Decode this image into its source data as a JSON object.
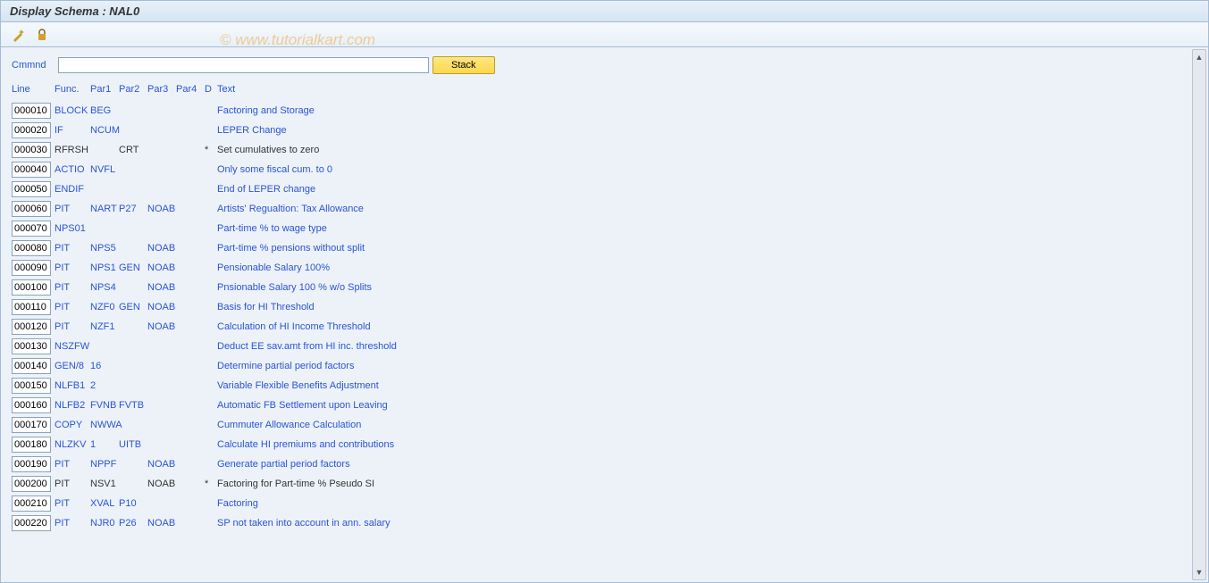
{
  "window": {
    "title": "Display Schema : NAL0"
  },
  "toolbar": {
    "icon1": "wand-icon",
    "icon2": "lock-icon"
  },
  "watermark": "© www.tutorialkart.com",
  "command": {
    "label": "Cmmnd",
    "value": "",
    "stack_label": "Stack"
  },
  "headers": {
    "line": "Line",
    "func": "Func.",
    "par1": "Par1",
    "par2": "Par2",
    "par3": "Par3",
    "par4": "Par4",
    "d": "D",
    "text": "Text"
  },
  "rows": [
    {
      "line": "000010",
      "func": "BLOCK",
      "par1": "BEG",
      "par2": "",
      "par3": "",
      "par4": "",
      "d": "",
      "text": "Factoring and Storage",
      "link": true
    },
    {
      "line": "000020",
      "func": "IF",
      "par1": "NCUM",
      "par2": "",
      "par3": "",
      "par4": "",
      "d": "",
      "text": "LEPER Change",
      "link": true
    },
    {
      "line": "000030",
      "func": "RFRSH",
      "par1": "",
      "par2": "CRT",
      "par3": "",
      "par4": "",
      "d": "*",
      "text": "Set cumulatives to zero",
      "link": false
    },
    {
      "line": "000040",
      "func": "ACTIO",
      "par1": "NVFL",
      "par2": "",
      "par3": "",
      "par4": "",
      "d": "",
      "text": "Only some fiscal cum. to 0",
      "link": true
    },
    {
      "line": "000050",
      "func": "ENDIF",
      "par1": "",
      "par2": "",
      "par3": "",
      "par4": "",
      "d": "",
      "text": "End of LEPER change",
      "link": true
    },
    {
      "line": "000060",
      "func": "PIT",
      "par1": "NART",
      "par2": "P27",
      "par3": "NOAB",
      "par4": "",
      "d": "",
      "text": "Artists' Regualtion: Tax Allowance",
      "link": true
    },
    {
      "line": "000070",
      "func": "NPS01",
      "par1": "",
      "par2": "",
      "par3": "",
      "par4": "",
      "d": "",
      "text": "Part-time % to wage type",
      "link": true
    },
    {
      "line": "000080",
      "func": "PIT",
      "par1": "NPS5",
      "par2": "",
      "par3": "NOAB",
      "par4": "",
      "d": "",
      "text": "Part-time % pensions without split",
      "link": true
    },
    {
      "line": "000090",
      "func": "PIT",
      "par1": "NPS1",
      "par2": "GEN",
      "par3": "NOAB",
      "par4": "",
      "d": "",
      "text": "Pensionable Salary 100%",
      "link": true
    },
    {
      "line": "000100",
      "func": "PIT",
      "par1": "NPS4",
      "par2": "",
      "par3": "NOAB",
      "par4": "",
      "d": "",
      "text": "Pnsionable Salary 100 % w/o Splits",
      "link": true
    },
    {
      "line": "000110",
      "func": "PIT",
      "par1": "NZF0",
      "par2": "GEN",
      "par3": "NOAB",
      "par4": "",
      "d": "",
      "text": "Basis for HI Threshold",
      "link": true
    },
    {
      "line": "000120",
      "func": "PIT",
      "par1": "NZF1",
      "par2": "",
      "par3": "NOAB",
      "par4": "",
      "d": "",
      "text": "Calculation of HI Income Threshold",
      "link": true
    },
    {
      "line": "000130",
      "func": "NSZFW",
      "par1": "",
      "par2": "",
      "par3": "",
      "par4": "",
      "d": "",
      "text": "Deduct EE sav.amt from HI inc. threshold",
      "link": true
    },
    {
      "line": "000140",
      "func": "GEN/8",
      "par1": "16",
      "par2": "",
      "par3": "",
      "par4": "",
      "d": "",
      "text": "Determine partial period factors",
      "link": true
    },
    {
      "line": "000150",
      "func": "NLFB1",
      "par1": "2",
      "par2": "",
      "par3": "",
      "par4": "",
      "d": "",
      "text": "Variable Flexible Benefits Adjustment",
      "link": true
    },
    {
      "line": "000160",
      "func": "NLFB2",
      "par1": "FVNB",
      "par2": "FVTB",
      "par3": "",
      "par4": "",
      "d": "",
      "text": "Automatic FB Settlement upon Leaving",
      "link": true
    },
    {
      "line": "000170",
      "func": "COPY",
      "par1": "NWWA",
      "par2": "",
      "par3": "",
      "par4": "",
      "d": "",
      "text": "Cummuter Allowance Calculation",
      "link": true
    },
    {
      "line": "000180",
      "func": "NLZKV",
      "par1": "1",
      "par2": "UITB",
      "par3": "",
      "par4": "",
      "d": "",
      "text": "Calculate HI premiums and contributions",
      "link": true
    },
    {
      "line": "000190",
      "func": "PIT",
      "par1": "NPPF",
      "par2": "",
      "par3": "NOAB",
      "par4": "",
      "d": "",
      "text": "Generate partial period factors",
      "link": true
    },
    {
      "line": "000200",
      "func": "PIT",
      "par1": "NSV1",
      "par2": "",
      "par3": "NOAB",
      "par4": "",
      "d": "*",
      "text": "Factoring for Part-time % Pseudo SI",
      "link": false
    },
    {
      "line": "000210",
      "func": "PIT",
      "par1": "XVAL",
      "par2": "P10",
      "par3": "",
      "par4": "",
      "d": "",
      "text": "Factoring",
      "link": true
    },
    {
      "line": "000220",
      "func": "PIT",
      "par1": "NJR0",
      "par2": "P26",
      "par3": "NOAB",
      "par4": "",
      "d": "",
      "text": "SP not taken into account in ann. salary",
      "link": true
    }
  ]
}
